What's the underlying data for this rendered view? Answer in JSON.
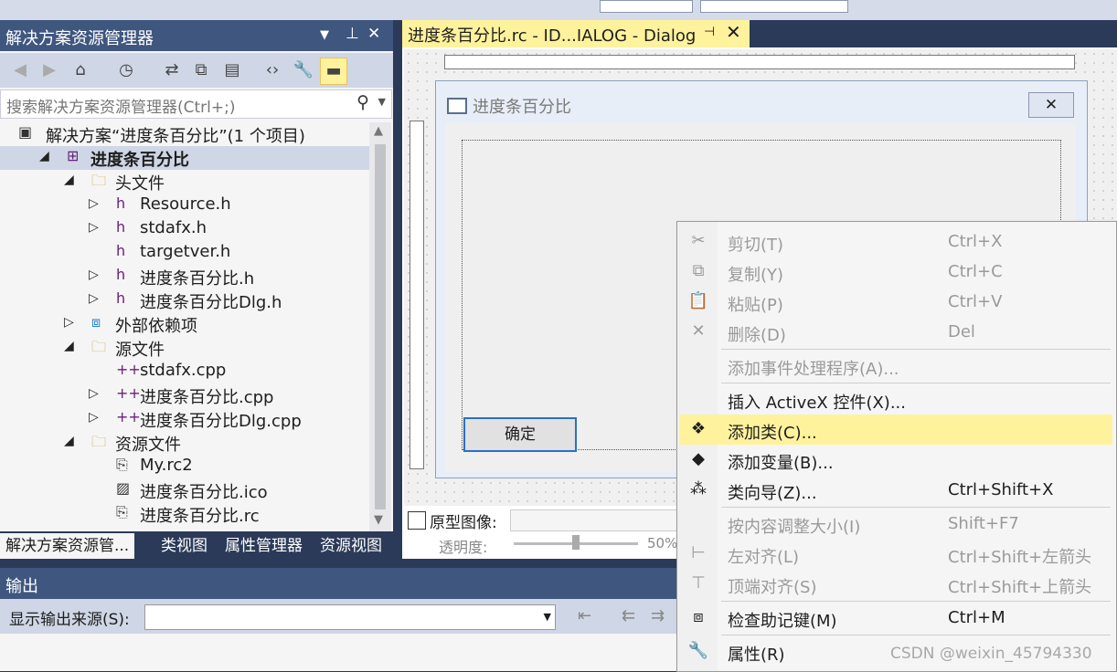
{
  "solution_explorer": {
    "title": "解决方案资源管理器",
    "search_placeholder": "搜索解决方案资源管理器(Ctrl+;)",
    "tree": [
      {
        "label": "解决方案“进度条百分比”(1 个项目)",
        "icon": "solution-icon",
        "expander": ""
      },
      {
        "label": "进度条百分比",
        "icon": "project-icon",
        "expander": "◢",
        "selected": true
      },
      {
        "label": "头文件",
        "icon": "folder-icon",
        "expander": "◢"
      },
      {
        "label": "Resource.h",
        "icon": "header-file-icon",
        "expander": "▷"
      },
      {
        "label": "stdafx.h",
        "icon": "header-file-icon",
        "expander": "▷"
      },
      {
        "label": "targetver.h",
        "icon": "header-file-icon",
        "expander": ""
      },
      {
        "label": "进度条百分比.h",
        "icon": "header-file-icon",
        "expander": "▷"
      },
      {
        "label": "进度条百分比Dlg.h",
        "icon": "header-file-icon",
        "expander": "▷"
      },
      {
        "label": "外部依赖项",
        "icon": "external-deps-icon",
        "expander": "▷"
      },
      {
        "label": "源文件",
        "icon": "folder-icon",
        "expander": "◢"
      },
      {
        "label": "stdafx.cpp",
        "icon": "cpp-file-icon",
        "expander": ""
      },
      {
        "label": "进度条百分比.cpp",
        "icon": "cpp-file-icon",
        "expander": "▷"
      },
      {
        "label": "进度条百分比Dlg.cpp",
        "icon": "cpp-file-icon",
        "expander": "▷"
      },
      {
        "label": "资源文件",
        "icon": "folder-icon",
        "expander": "◢"
      },
      {
        "label": "My.rc2",
        "icon": "resource-file-icon",
        "expander": ""
      },
      {
        "label": "进度条百分比.ico",
        "icon": "image-file-icon",
        "expander": ""
      },
      {
        "label": "进度条百分比.rc",
        "icon": "resource-file-icon",
        "expander": ""
      }
    ],
    "bottom_tabs": [
      "解决方案资源管...",
      "类视图",
      "属性管理器",
      "资源视图"
    ]
  },
  "document": {
    "tab_title": "进度条百分比.rc - ID...IALOG - Dialog",
    "dialog_title": "进度条百分比",
    "ok_button": "确定",
    "original_image_label": "原型图像:",
    "opacity_label": "透明度:",
    "opacity_value": "50%",
    "opacity_fraction": 0.5
  },
  "output": {
    "title": "输出",
    "source_label": "显示输出来源(S):",
    "source_value": ""
  },
  "context_menu": {
    "items": [
      {
        "label": "剪切(T)",
        "shortcut": "Ctrl+X",
        "icon": "scissors-icon",
        "disabled": true
      },
      {
        "label": "复制(Y)",
        "shortcut": "Ctrl+C",
        "icon": "copy-icon",
        "disabled": true
      },
      {
        "label": "粘贴(P)",
        "shortcut": "Ctrl+V",
        "icon": "paste-icon",
        "disabled": true
      },
      {
        "label": "删除(D)",
        "shortcut": "Del",
        "icon": "delete-icon",
        "disabled": true
      },
      {
        "sep": true
      },
      {
        "label": "添加事件处理程序(A)...",
        "shortcut": "",
        "icon": "",
        "disabled": true
      },
      {
        "sep": true
      },
      {
        "label": "插入 ActiveX 控件(X)...",
        "shortcut": "",
        "icon": "",
        "disabled": false
      },
      {
        "label": "添加类(C)...",
        "shortcut": "",
        "icon": "add-class-icon",
        "disabled": false,
        "highlighted": true
      },
      {
        "label": "添加变量(B)...",
        "shortcut": "",
        "icon": "add-variable-icon",
        "disabled": false
      },
      {
        "label": "类向导(Z)...",
        "shortcut": "Ctrl+Shift+X",
        "icon": "class-wizard-icon",
        "disabled": false
      },
      {
        "sep": true
      },
      {
        "label": "按内容调整大小(I)",
        "shortcut": "Shift+F7",
        "icon": "",
        "disabled": true
      },
      {
        "label": "左对齐(L)",
        "shortcut": "Ctrl+Shift+左箭头",
        "icon": "align-left-icon",
        "disabled": true
      },
      {
        "label": "顶端对齐(S)",
        "shortcut": "Ctrl+Shift+上箭头",
        "icon": "align-top-icon",
        "disabled": true
      },
      {
        "sep": true
      },
      {
        "label": "检查助记键(M)",
        "shortcut": "Ctrl+M",
        "icon": "check-mnemonics-icon",
        "disabled": false
      },
      {
        "sep": true
      },
      {
        "label": "属性(R)",
        "shortcut": "",
        "icon": "wrench-icon",
        "disabled": false
      }
    ]
  },
  "watermark": "CSDN @weixin_45794330"
}
